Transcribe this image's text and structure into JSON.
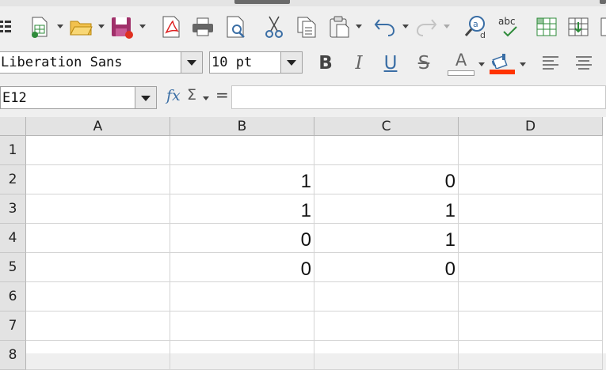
{
  "toolbar1": {
    "icons": [
      "menu-icon",
      "new-spreadsheet-icon",
      "open-folder-icon",
      "save-icon",
      "export-pdf-icon",
      "print-icon",
      "print-preview-icon",
      "cut-icon",
      "copy-icon",
      "paste-icon",
      "undo-icon",
      "redo-icon",
      "find-replace-icon",
      "spellcheck-icon",
      "row-insert-icon",
      "column-insert-icon"
    ]
  },
  "toolbar2": {
    "font_name": "Liberation Sans",
    "font_size": "10 pt",
    "bold_label": "B",
    "italic_label": "I",
    "underline_label": "U",
    "strikethrough_label": "S",
    "font_color_label": "A",
    "font_color": "#ff3300",
    "highlight_color": "#ff3300"
  },
  "formula_bar": {
    "name_box": "E12",
    "fx_label": "fx",
    "sigma_label": "Σ",
    "equals_label": "=",
    "content": ""
  },
  "sheet": {
    "columns": [
      "A",
      "B",
      "C",
      "D"
    ],
    "rows": [
      {
        "label": "1",
        "cells": [
          "",
          "",
          "",
          ""
        ]
      },
      {
        "label": "2",
        "cells": [
          "",
          "1",
          "0",
          ""
        ]
      },
      {
        "label": "3",
        "cells": [
          "",
          "1",
          "1",
          ""
        ]
      },
      {
        "label": "4",
        "cells": [
          "",
          "0",
          "1",
          ""
        ]
      },
      {
        "label": "5",
        "cells": [
          "",
          "0",
          "0",
          ""
        ]
      },
      {
        "label": "6",
        "cells": [
          "",
          "",
          "",
          ""
        ]
      },
      {
        "label": "7",
        "cells": [
          "",
          "",
          "",
          ""
        ]
      },
      {
        "label": "8",
        "cells": [
          "",
          "",
          "",
          ""
        ]
      }
    ]
  }
}
